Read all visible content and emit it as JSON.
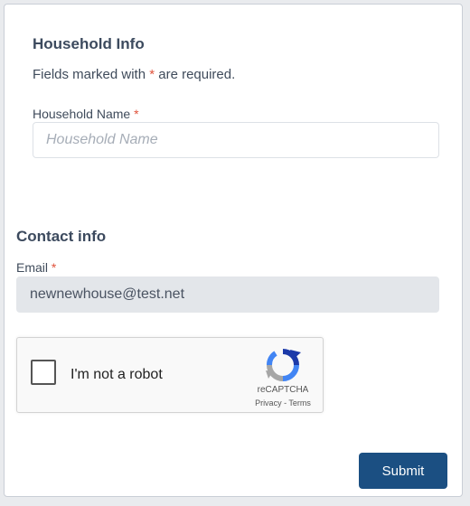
{
  "household": {
    "title": "Household Info",
    "required_note_prefix": "Fields marked with",
    "required_marker": "*",
    "required_note_suffix": "are required.",
    "name_label": "Household Name",
    "name_placeholder": "Household Name",
    "name_value": ""
  },
  "contact": {
    "title": "Contact info",
    "email_label": "Email",
    "email_value": "newnewhouse@test.net"
  },
  "recaptcha": {
    "checkbox_label": "I'm not a robot",
    "brand": "reCAPTCHA",
    "privacy": "Privacy",
    "separator": " - ",
    "terms": "Terms",
    "checked": false
  },
  "actions": {
    "submit_label": "Submit"
  },
  "colors": {
    "accent": "#1b4f82",
    "required": "#e0533c",
    "heading": "#3c4a5e"
  }
}
